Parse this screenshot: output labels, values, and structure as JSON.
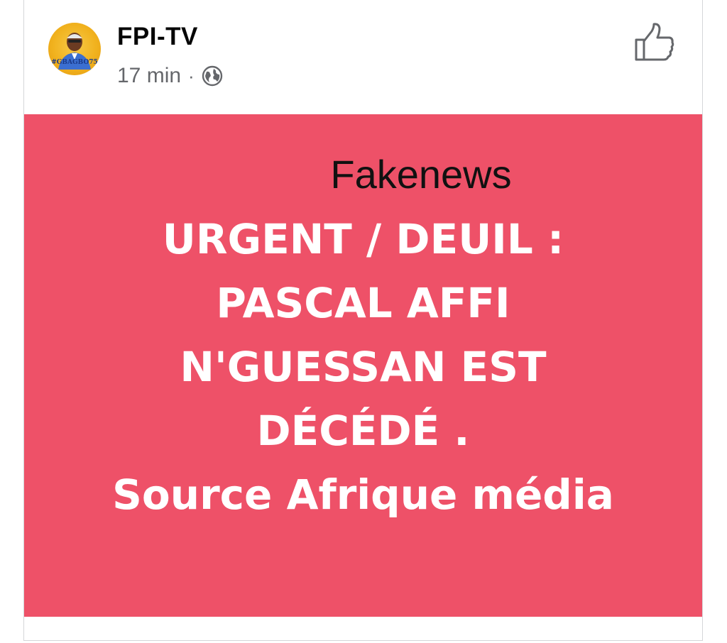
{
  "post": {
    "page_name": "FPI-TV",
    "timestamp": "17 min",
    "separator": "·",
    "privacy_icon": "globe-icon",
    "avatar_tag": "#GBAGBO75",
    "like_icon": "thumbs-up-icon"
  },
  "image": {
    "background_color": "#ee5168",
    "overlay_label": "Fakenews",
    "headline_lines": [
      "URGENT / DEUIL :",
      "PASCAL AFFI",
      "N'GUESSAN EST",
      "DÉCÉDÉ .",
      "Source Afrique média"
    ]
  }
}
